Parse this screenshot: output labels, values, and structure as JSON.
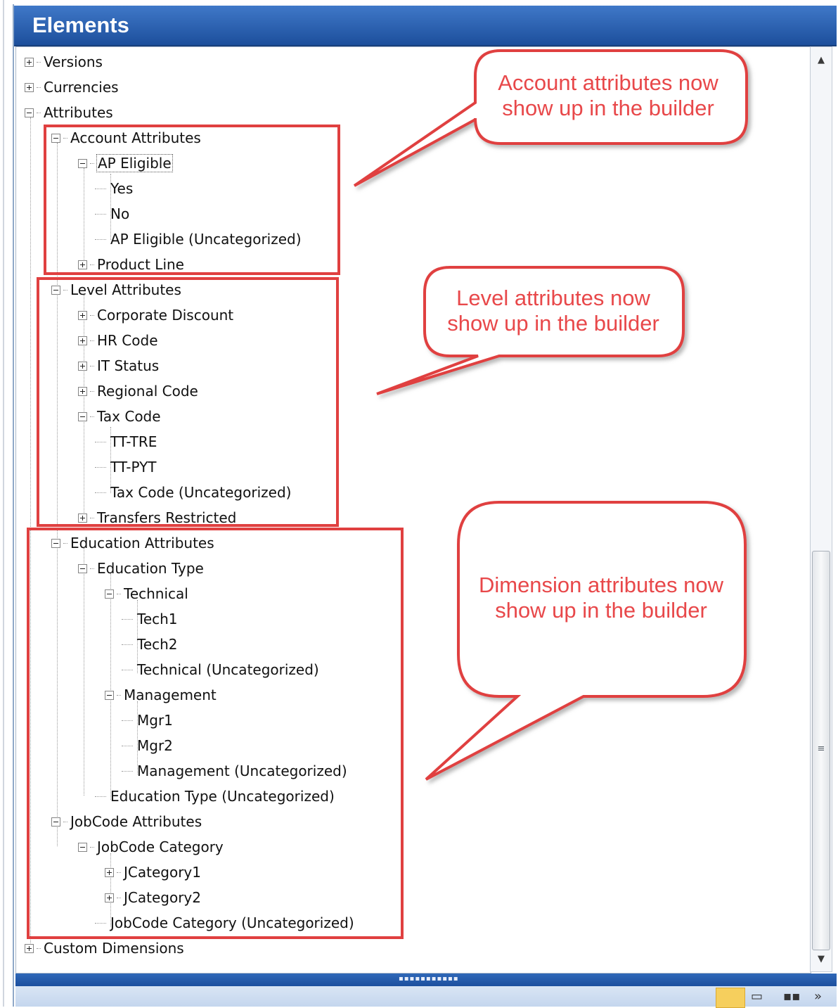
{
  "panel": {
    "title": "Elements"
  },
  "tree": [
    {
      "label": "Versions",
      "state": "collapsed"
    },
    {
      "label": "Currencies",
      "state": "collapsed"
    },
    {
      "label": "Attributes",
      "state": "expanded"
    },
    {
      "label": "Account Attributes",
      "state": "expanded"
    },
    {
      "label": "AP Eligible",
      "state": "expanded",
      "selected": true
    },
    {
      "label": "Yes",
      "state": "leaf"
    },
    {
      "label": "No",
      "state": "leaf"
    },
    {
      "label": "AP Eligible (Uncategorized)",
      "state": "leaf"
    },
    {
      "label": "Product Line",
      "state": "collapsed"
    },
    {
      "label": "Level Attributes",
      "state": "expanded"
    },
    {
      "label": "Corporate Discount",
      "state": "collapsed"
    },
    {
      "label": "HR Code",
      "state": "collapsed"
    },
    {
      "label": "IT Status",
      "state": "collapsed"
    },
    {
      "label": "Regional Code",
      "state": "collapsed"
    },
    {
      "label": "Tax Code",
      "state": "expanded"
    },
    {
      "label": "TT-TRE",
      "state": "leaf"
    },
    {
      "label": "TT-PYT",
      "state": "leaf"
    },
    {
      "label": "Tax Code (Uncategorized)",
      "state": "leaf"
    },
    {
      "label": "Transfers Restricted",
      "state": "collapsed"
    },
    {
      "label": "Education Attributes",
      "state": "expanded"
    },
    {
      "label": "Education Type",
      "state": "expanded"
    },
    {
      "label": "Technical",
      "state": "expanded"
    },
    {
      "label": "Tech1",
      "state": "leaf"
    },
    {
      "label": "Tech2",
      "state": "leaf"
    },
    {
      "label": "Technical (Uncategorized)",
      "state": "leaf"
    },
    {
      "label": "Management",
      "state": "expanded"
    },
    {
      "label": "Mgr1",
      "state": "leaf"
    },
    {
      "label": "Mgr2",
      "state": "leaf"
    },
    {
      "label": "Management (Uncategorized)",
      "state": "leaf"
    },
    {
      "label": "Education Type (Uncategorized)",
      "state": "leaf"
    },
    {
      "label": "JobCode Attributes",
      "state": "expanded"
    },
    {
      "label": "JobCode Category",
      "state": "expanded"
    },
    {
      "label": "JCategory1",
      "state": "collapsed"
    },
    {
      "label": "JCategory2",
      "state": "collapsed"
    },
    {
      "label": "JobCode Category (Uncategorized)",
      "state": "leaf"
    },
    {
      "label": "Custom Dimensions",
      "state": "collapsed"
    }
  ],
  "callouts": {
    "account": {
      "line1": "Account attributes now",
      "line2": "show up in the builder"
    },
    "level": {
      "line1": "Level attributes now",
      "line2": "show up in the builder"
    },
    "dimension": {
      "line1": "Dimension attributes now",
      "line2": "show up in the builder"
    }
  },
  "colors": {
    "header": "#2a5fae",
    "annotation": "#e04040"
  },
  "icons": [
    "plus-toggle-icon",
    "minus-toggle-icon",
    "scroll-up-icon",
    "scroll-down-icon",
    "calendar-icon",
    "chevron-double-right-icon"
  ]
}
